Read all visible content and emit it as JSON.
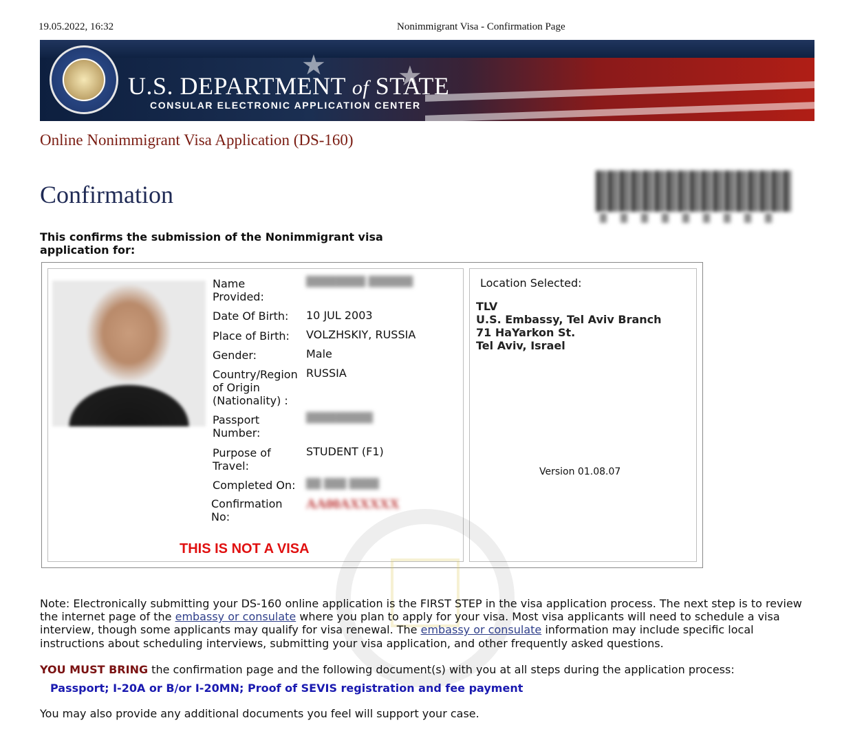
{
  "print_header": {
    "datetime": "19.05.2022, 16:32",
    "title": "Nonimmigrant Visa - Confirmation Page"
  },
  "banner": {
    "dept_prefix": "U.S. DEPARTMENT",
    "dept_of": "of",
    "dept_suffix": "STATE",
    "subtitle": "CONSULAR ELECTRONIC APPLICATION CENTER"
  },
  "app_title": "Online Nonimmigrant Visa Application (DS-160)",
  "heading": "Confirmation",
  "intro": "This confirms the submission of the Nonimmigrant visa application for:",
  "applicant": {
    "name_label": "Name Provided:",
    "dob_label": "Date Of Birth:",
    "dob": "10 JUL 2003",
    "pob_label": "Place of Birth:",
    "pob": "VOLZHSKIY, RUSSIA",
    "gender_label": "Gender:",
    "gender": "Male",
    "nationality_label": "Country/Region of Origin (Nationality) :",
    "nationality": "RUSSIA",
    "passport_label": "Passport Number:",
    "purpose_label": "Purpose of Travel:",
    "purpose": "STUDENT (F1)",
    "completed_label": "Completed On:",
    "confirmation_label": "Confirmation No:"
  },
  "not_visa": "THIS IS NOT A VISA",
  "location": {
    "label": "Location Selected:",
    "code": "TLV",
    "name": "U.S. Embassy, Tel Aviv Branch",
    "street": "71 HaYarkon St.",
    "city": "Tel Aviv, Israel",
    "version": "Version 01.08.07"
  },
  "note": {
    "part1": "Note: Electronically submitting your DS-160 online application is the FIRST STEP in the visa application process. The next step is to review the internet page of the ",
    "link1": "embassy or consulate",
    "part2": " where you plan to apply for your visa. Most visa applicants will need to schedule a visa interview, though some applicants may qualify for visa renewal. The ",
    "link2": "embassy or consulate",
    "part3": " information may include specific local instructions about scheduling interviews, submitting your visa application, and other frequently asked questions."
  },
  "must_bring": {
    "emphasis": "YOU MUST BRING",
    "rest": " the confirmation page and the following document(s) with you at all steps during the application process:",
    "documents": "Passport; I-20A or B/or I-20MN; Proof of SEVIS registration and fee payment"
  },
  "extra": "You may also provide any additional documents you feel will support your case."
}
